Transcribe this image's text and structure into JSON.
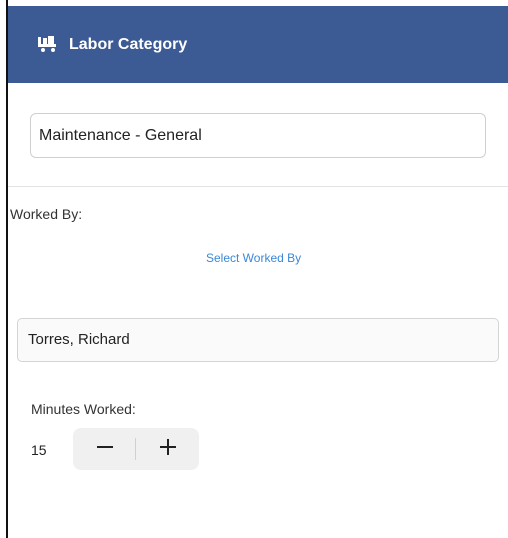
{
  "header": {
    "title": "Labor Category",
    "icon": "cart-icon",
    "background_color": "#3c5a94"
  },
  "labor_category": {
    "value": "Maintenance - General"
  },
  "worked_by": {
    "label": "Worked By:",
    "select_link": "Select Worked By",
    "selected_worker": "Torres, Richard",
    "link_color": "#3a88d8"
  },
  "minutes_worked": {
    "label": "Minutes Worked:",
    "value": "15",
    "decrement_icon": "minus-icon",
    "increment_icon": "plus-icon"
  }
}
